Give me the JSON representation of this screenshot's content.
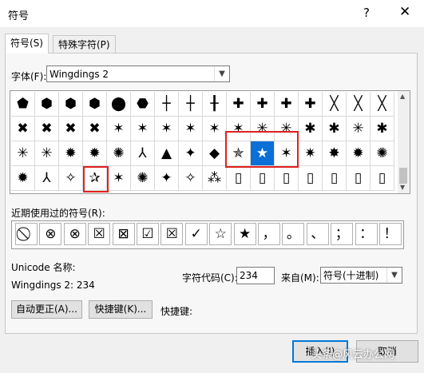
{
  "window": {
    "title": "符号",
    "help": "?",
    "close": "✕"
  },
  "tabs": [
    {
      "label": "符号(S)"
    },
    {
      "label": "特殊字符(P)"
    }
  ],
  "font": {
    "label": "字体(F):",
    "value": "Wingdings 2"
  },
  "grid": {
    "rows": [
      [
        "⬟",
        "⬢",
        "⬢",
        "⬢",
        "⬤",
        "⬣",
        "┼",
        "┼",
        "╂",
        "✚",
        "✚",
        "✚",
        "✚",
        "╳",
        "╳",
        "╳"
      ],
      [
        "✖",
        "✖",
        "✖",
        "✖",
        "✶",
        "✶",
        "✶",
        "✶",
        "✶",
        "✶",
        "✳",
        "✳",
        "✱",
        "✱",
        "✳",
        "✱"
      ],
      [
        "✳",
        "✳",
        "✹",
        "✹",
        "✺",
        "⅄",
        "▲",
        "✦",
        "◆",
        "✯",
        "★",
        "✶",
        "✷",
        "✸",
        "✹",
        "✺"
      ],
      [
        "✹",
        "⅄",
        "✧",
        "✰",
        "✶",
        "✺",
        "✦",
        "✧",
        "⁂",
        "▯",
        "▯",
        "▯",
        "▯",
        "▯",
        "▯",
        "▯"
      ]
    ],
    "selected": {
      "row": 2,
      "col": 10
    }
  },
  "recent": {
    "label": "近期使用过的符号(R):",
    "items": [
      "⃠",
      "⊗",
      "⊗",
      "☒",
      "⊠",
      "☑",
      "☒",
      "✓",
      "☆",
      "★",
      "，",
      "。",
      "、",
      "；",
      "：",
      "！"
    ]
  },
  "info": {
    "unicode_name_label": "Unicode 名称:",
    "char_desc": "Wingdings 2: 234",
    "code_label": "字符代码(C):",
    "code_value": "234",
    "from_label": "来自(M):",
    "from_value": "符号(十进制)"
  },
  "buttons": {
    "autocorrect": "自动更正(A)...",
    "shortcut_key": "快捷键(K)...",
    "shortcut_label": "快捷键:",
    "insert": "插入(I)",
    "cancel": "取消"
  },
  "watermark": "头条@风云办公网"
}
